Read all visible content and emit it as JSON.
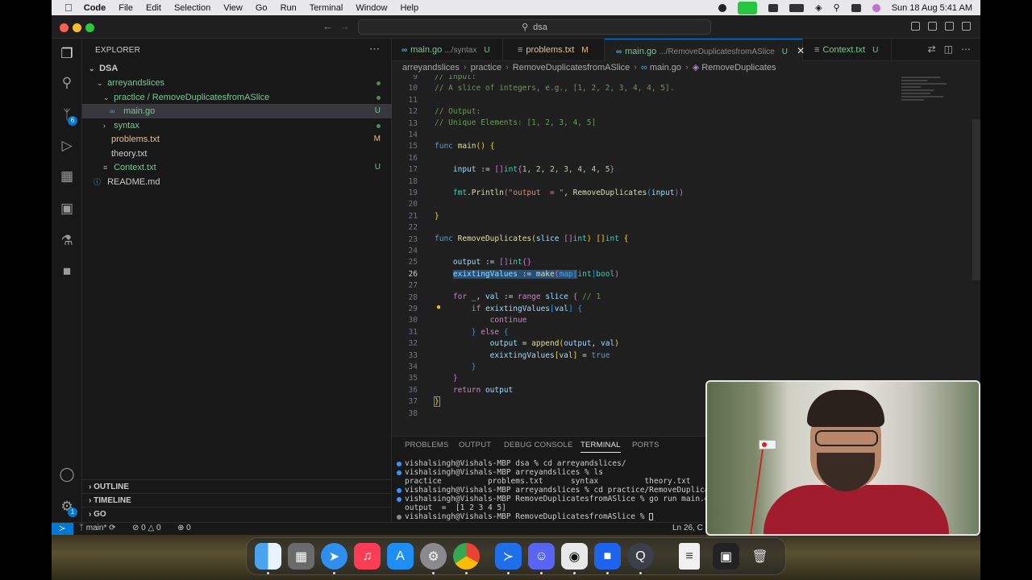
{
  "menubar": {
    "app": "Code",
    "menus": [
      "File",
      "Edit",
      "Selection",
      "View",
      "Go",
      "Run",
      "Terminal",
      "Window",
      "Help"
    ],
    "datetime": "Sun 18 Aug  5:41 AM"
  },
  "titlebar": {
    "search": "dsa"
  },
  "activity": {
    "scm_badge": "6",
    "settings_badge": "1"
  },
  "explorer": {
    "title": "EXPLORER",
    "root": "DSA",
    "items": [
      {
        "label": "arreyandslices",
        "status": ""
      },
      {
        "label": "practice / RemoveDuplicatesfromASlice",
        "status": ""
      },
      {
        "label": "main.go",
        "status": "U"
      },
      {
        "label": "syntax",
        "status": ""
      },
      {
        "label": "problems.txt",
        "status": "M"
      },
      {
        "label": "theory.txt",
        "status": ""
      },
      {
        "label": "Context.txt",
        "status": "U"
      },
      {
        "label": "README.md",
        "status": ""
      }
    ],
    "outline": "OUTLINE",
    "timeline": "TIMELINE",
    "go": "GO"
  },
  "tabs": [
    {
      "name": "main.go",
      "path": ".../syntax",
      "status": "U"
    },
    {
      "name": "problems.txt",
      "path": "",
      "status": "M"
    },
    {
      "name": "main.go",
      "path": ".../RemoveDuplicatesfromASlice",
      "status": "U"
    },
    {
      "name": "Context.txt",
      "path": "",
      "status": "U"
    }
  ],
  "breadcrumb": [
    "arreyandslices",
    "practice",
    "RemoveDuplicatesfromASlice",
    "main.go",
    "RemoveDuplicates"
  ],
  "code": {
    "line_numbers": [
      "9",
      "10",
      "11",
      "12",
      "13",
      "14",
      "15",
      "16",
      "17",
      "18",
      "19",
      "20",
      "21",
      "22",
      "23",
      "24",
      "25",
      "26",
      "27",
      "28",
      "29",
      "30",
      "31",
      "32",
      "33",
      "34",
      "35",
      "36",
      "37",
      "38"
    ],
    "l9": "// Input:",
    "l10": "// A slice of integers, e.g., [1, 2, 2, 3, 4, 4, 5].",
    "l12": "// Output:",
    "l13": "// Unique Elements: [1, 2, 3, 4, 5]",
    "func": "func",
    "main": "main",
    "remdup": "RemoveDuplicates",
    "input": "input",
    "output": "output",
    "exist": "exixtingValues",
    "int": "int",
    "bool": "bool",
    "slice": "slice",
    "make": "make",
    "map": "map",
    "range": "range",
    "for": "for",
    "if": "if",
    "else": "else",
    "continue": "continue",
    "return": "return",
    "append": "append",
    "fmt": "fmt",
    "println": "Println",
    "str": "\"output  = \"",
    "true": "true",
    "val": "val",
    "nums": "1, 2, 2, 3, 4, 4, 5",
    "cm1": "// 1"
  },
  "panel": {
    "tabs": [
      "PROBLEMS",
      "OUTPUT",
      "DEBUG CONSOLE",
      "TERMINAL",
      "PORTS"
    ],
    "lines": [
      "vishalsingh@Vishals-MBP dsa % cd arreyandslices/",
      "vishalsingh@Vishals-MBP arreyandslices % ls",
      "practice          problems.txt      syntax          theory.txt",
      "vishalsingh@Vishals-MBP arreyandslices % cd practice/RemoveDuplica",
      "vishalsingh@Vishals-MBP RemoveDuplicatesfromASlice % go run main.go",
      "output  =  [1 2 3 4 5]",
      "vishalsingh@Vishals-MBP RemoveDuplicatesfromASlice % "
    ]
  },
  "status": {
    "branch": "main*",
    "errors": "0",
    "warnings": "0",
    "ports": "0",
    "position": "Ln 26, C"
  },
  "colors": {
    "accent": "#0078d4",
    "bg": "#1f1f1f",
    "sidebar": "#181818"
  }
}
